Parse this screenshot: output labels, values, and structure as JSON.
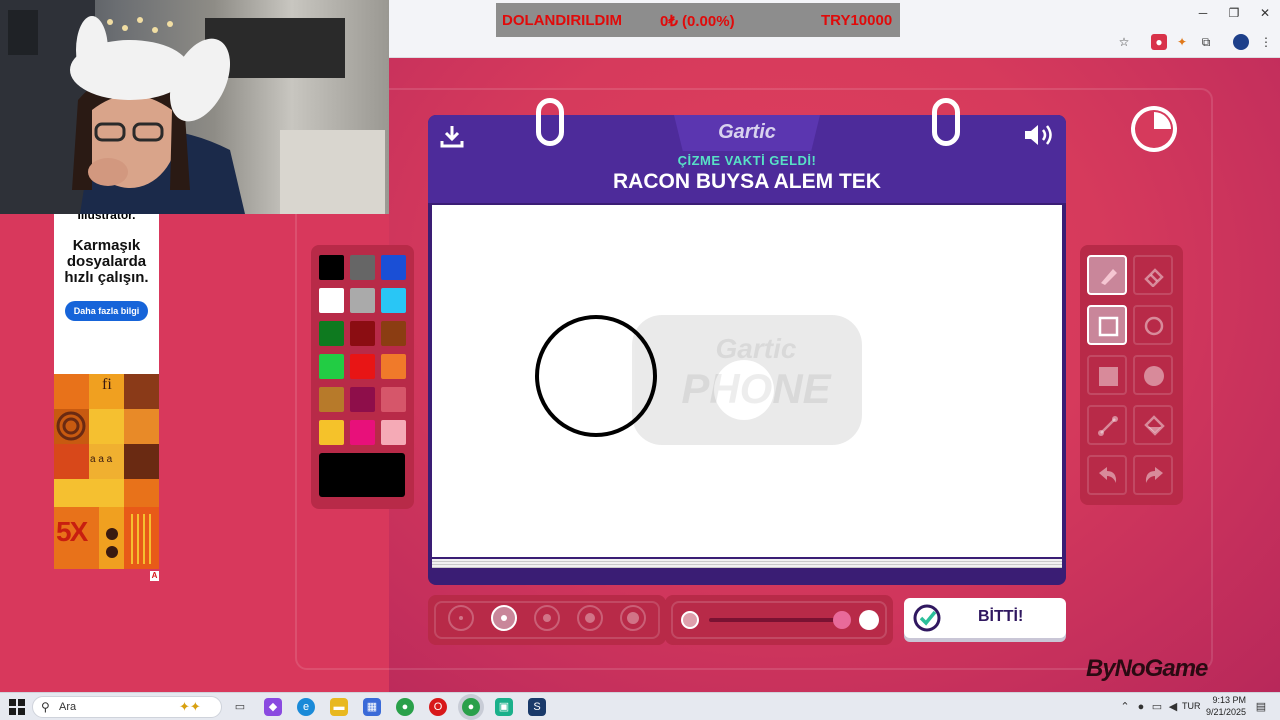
{
  "donation": {
    "label": "DOLANDIRILDIM",
    "amount": "0₺ (0.00%)",
    "goal": "TRY10000"
  },
  "ad": {
    "top_text": "Illustrator.",
    "headline": "Karmaşık dosyalarda hızlı çalışın.",
    "cta": "Daha fazla bilgi",
    "tile_fi": "fi",
    "tile_aaa": "a a a",
    "tile_5x": "5X",
    "badge": "A"
  },
  "game": {
    "logo": "Gartic",
    "subtitle": "ÇİZME VAKTİ GELDİ!",
    "prompt": "RACON BUYSA ALEM TEK",
    "done_label": "BİTTİ!",
    "watermark_top": "Gartic",
    "watermark_bottom": "PHONE",
    "timer_fraction_remaining": 0.25
  },
  "palette": [
    "#000000",
    "#666666",
    "#1a4fd6",
    "#ffffff",
    "#aaaaaa",
    "#29c6f5",
    "#0e7a1f",
    "#8b0d12",
    "#8b3d12",
    "#22cc44",
    "#e81515",
    "#f07a2a",
    "#b77a2a",
    "#8e0e4a",
    "#d6566a",
    "#f5c22a",
    "#e8107a",
    "#f5aab6"
  ],
  "current_color": "#000000",
  "tools": [
    "pencil-icon",
    "eraser-icon",
    "rect-outline-icon",
    "ellipse-outline-icon",
    "rect-filled-icon",
    "ellipse-filled-icon",
    "line-icon",
    "fill-bucket-icon",
    "undo-icon",
    "redo-icon"
  ],
  "sizes": [
    1,
    2,
    3,
    4,
    5
  ],
  "selected_size": 2,
  "opacity_level": 1.0,
  "brand": "ByNoGame",
  "taskbar": {
    "search_placeholder": "Ara",
    "language": "TUR",
    "time": "9:13 PM",
    "date": "9/21/2025"
  }
}
